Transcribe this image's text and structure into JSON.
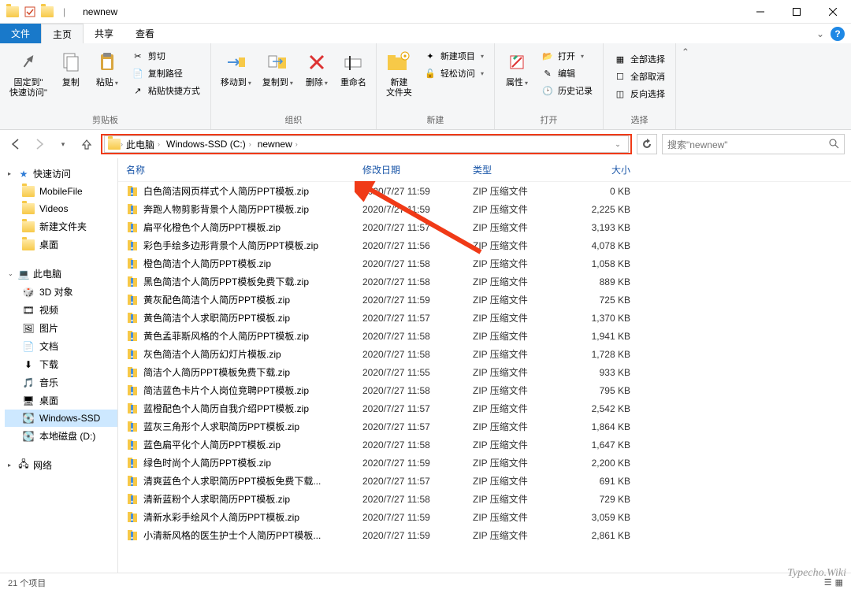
{
  "title": "newnew",
  "tabs": {
    "file": "文件",
    "home": "主页",
    "share": "共享",
    "view": "查看"
  },
  "ribbon": {
    "clipboard": {
      "pin_label": "固定到\"\n快速访问\"",
      "copy": "复制",
      "paste": "粘贴",
      "cut": "剪切",
      "copypath": "复制路径",
      "pasteshortcut": "粘贴快捷方式",
      "group": "剪贴板"
    },
    "organize": {
      "moveto": "移动到",
      "copyto": "复制到",
      "delete": "删除",
      "rename": "重命名",
      "group": "组织"
    },
    "new": {
      "newfolder": "新建\n文件夹",
      "newitem": "新建项目",
      "easyaccess": "轻松访问",
      "group": "新建"
    },
    "open": {
      "properties": "属性",
      "open": "打开",
      "edit": "编辑",
      "history": "历史记录",
      "group": "打开"
    },
    "select": {
      "selectall": "全部选择",
      "selectnone": "全部取消",
      "invert": "反向选择",
      "group": "选择"
    }
  },
  "breadcrumb": [
    "此电脑",
    "Windows-SSD (C:)",
    "newnew"
  ],
  "search_placeholder": "搜索\"newnew\"",
  "tree": {
    "quick": "快速访问",
    "quick_items": [
      "MobileFile",
      "Videos",
      "新建文件夹",
      "桌面"
    ],
    "thispc": "此电脑",
    "pc_items": [
      {
        "label": "3D 对象",
        "icon": "cube"
      },
      {
        "label": "视频",
        "icon": "video"
      },
      {
        "label": "图片",
        "icon": "picture"
      },
      {
        "label": "文档",
        "icon": "doc"
      },
      {
        "label": "下载",
        "icon": "download"
      },
      {
        "label": "音乐",
        "icon": "music"
      },
      {
        "label": "桌面",
        "icon": "desktop"
      },
      {
        "label": "Windows-SSD",
        "icon": "drive",
        "selected": true
      },
      {
        "label": "本地磁盘 (D:)",
        "icon": "drive"
      }
    ],
    "network": "网络"
  },
  "columns": {
    "name": "名称",
    "date": "修改日期",
    "type": "类型",
    "size": "大小"
  },
  "file_type": "ZIP 压缩文件",
  "files": [
    {
      "name": "白色简洁网页样式个人简历PPT模板.zip",
      "date": "2020/7/27 11:59",
      "size": "0 KB"
    },
    {
      "name": "奔跑人物剪影背景个人简历PPT模板.zip",
      "date": "2020/7/27 11:59",
      "size": "2,225 KB"
    },
    {
      "name": "扁平化橙色个人简历PPT模板.zip",
      "date": "2020/7/27 11:57",
      "size": "3,193 KB"
    },
    {
      "name": "彩色手绘多边形背景个人简历PPT模板.zip",
      "date": "2020/7/27 11:56",
      "size": "4,078 KB"
    },
    {
      "name": "橙色简洁个人简历PPT模板.zip",
      "date": "2020/7/27 11:58",
      "size": "1,058 KB"
    },
    {
      "name": "黑色简洁个人简历PPT模板免费下载.zip",
      "date": "2020/7/27 11:58",
      "size": "889 KB"
    },
    {
      "name": "黄灰配色简洁个人简历PPT模板.zip",
      "date": "2020/7/27 11:59",
      "size": "725 KB"
    },
    {
      "name": "黄色简洁个人求职简历PPT模板.zip",
      "date": "2020/7/27 11:57",
      "size": "1,370 KB"
    },
    {
      "name": "黄色孟菲斯风格的个人简历PPT模板.zip",
      "date": "2020/7/27 11:58",
      "size": "1,941 KB"
    },
    {
      "name": "灰色简洁个人简历幻灯片模板.zip",
      "date": "2020/7/27 11:58",
      "size": "1,728 KB"
    },
    {
      "name": "简洁个人简历PPT模板免费下载.zip",
      "date": "2020/7/27 11:55",
      "size": "933 KB"
    },
    {
      "name": "简洁蓝色卡片个人岗位竞聘PPT模板.zip",
      "date": "2020/7/27 11:58",
      "size": "795 KB"
    },
    {
      "name": "蓝橙配色个人简历自我介绍PPT模板.zip",
      "date": "2020/7/27 11:57",
      "size": "2,542 KB"
    },
    {
      "name": "蓝灰三角形个人求职简历PPT模板.zip",
      "date": "2020/7/27 11:57",
      "size": "1,864 KB"
    },
    {
      "name": "蓝色扁平化个人简历PPT模板.zip",
      "date": "2020/7/27 11:58",
      "size": "1,647 KB"
    },
    {
      "name": "绿色时尚个人简历PPT模板.zip",
      "date": "2020/7/27 11:59",
      "size": "2,200 KB"
    },
    {
      "name": "清爽蓝色个人求职简历PPT模板免费下载...",
      "date": "2020/7/27 11:57",
      "size": "691 KB"
    },
    {
      "name": "清新蓝粉个人求职简历PPT模板.zip",
      "date": "2020/7/27 11:58",
      "size": "729 KB"
    },
    {
      "name": "清新水彩手绘风个人简历PPT模板.zip",
      "date": "2020/7/27 11:59",
      "size": "3,059 KB"
    },
    {
      "name": "小清新风格的医生护士个人简历PPT模板...",
      "date": "2020/7/27 11:59",
      "size": "2,861 KB"
    }
  ],
  "status": "21 个项目",
  "watermark": "Typecho.Wiki"
}
